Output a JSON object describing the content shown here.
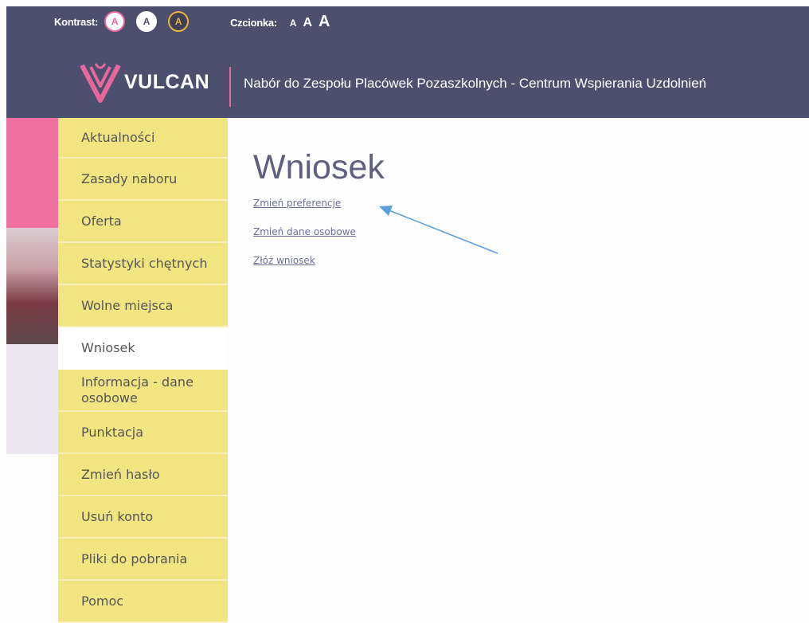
{
  "toolbar": {
    "contrast_label": "Kontrast:",
    "contrast_buttons": [
      "A",
      "A",
      "A"
    ],
    "font_label": "Czcionka:",
    "font_buttons": [
      "A",
      "A",
      "A"
    ]
  },
  "header": {
    "logo_text": "VULCAN",
    "title": "Nabór do Zespołu Placówek Pozaszkolnych - Centrum Wspierania Uzdolnień"
  },
  "nav": {
    "items": [
      {
        "label": "Aktualności"
      },
      {
        "label": "Zasady naboru"
      },
      {
        "label": "Oferta"
      },
      {
        "label": "Statystyki chętnych"
      },
      {
        "label": "Wolne miejsca"
      },
      {
        "label": "Wniosek",
        "active": true
      },
      {
        "label": "Informacja - dane osobowe"
      },
      {
        "label": "Punktacja"
      },
      {
        "label": "Zmień hasło"
      },
      {
        "label": "Usuń konto"
      },
      {
        "label": "Pliki do pobrania"
      },
      {
        "label": "Pomoc"
      }
    ]
  },
  "main": {
    "title": "Wniosek",
    "links": [
      "Zmień preferencje",
      "Zmień dane osobowe",
      "Złóż wniosek"
    ]
  },
  "colors": {
    "header_bg": "#4d4f6e",
    "nav_bg": "#f0e580",
    "accent_pink": "#e9689c",
    "arrow": "#5a9fd6"
  },
  "icons": {
    "logo": "vulcan-logo-icon",
    "arrow": "arrow-annotation-icon"
  }
}
